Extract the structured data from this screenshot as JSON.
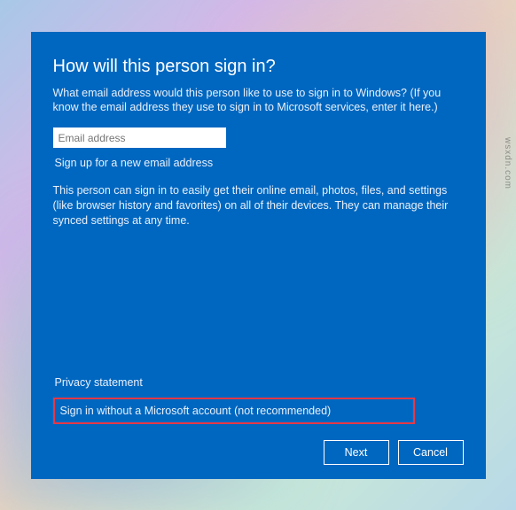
{
  "dialog": {
    "title": "How will this person sign in?",
    "subtitle": "What email address would this person like to use to sign in to Windows? (If you know the email address they use to sign in to Microsoft services, enter it here.)",
    "email_placeholder": "Email address",
    "signup_link": "Sign up for a new email address",
    "info_text": "This person can sign in to easily get their online email, photos, files, and settings (like browser history and favorites) on all of their devices. They can manage their synced settings at any time.",
    "privacy_link": "Privacy statement",
    "local_account_link": "Sign in without a Microsoft account (not recommended)",
    "next_button": "Next",
    "cancel_button": "Cancel"
  },
  "watermark": "wsxdn.com",
  "colors": {
    "dialog_bg": "#0067c0",
    "highlight_border": "#e63946"
  }
}
